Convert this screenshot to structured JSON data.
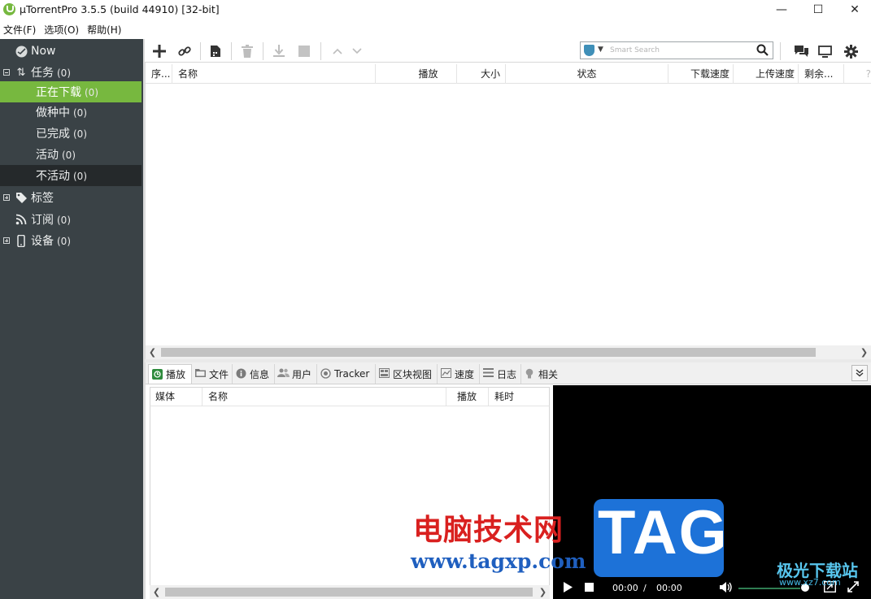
{
  "window": {
    "title": "µTorrentPro 3.5.5  (build 44910) [32-bit]",
    "minimize_glyph": "—",
    "maximize_glyph": "☐",
    "close_glyph": "✕"
  },
  "menu": [
    {
      "label": "文件(F)"
    },
    {
      "label": "选项(O)"
    },
    {
      "label": "帮助(H)"
    }
  ],
  "sidebar": {
    "now": "Now",
    "tasks": {
      "label": "任务",
      "count": "(0)"
    },
    "downloading": {
      "label": "正在下载",
      "count": "(0)"
    },
    "seeding": {
      "label": "做种中",
      "count": "(0)"
    },
    "completed": {
      "label": "已完成",
      "count": "(0)"
    },
    "active": {
      "label": "活动",
      "count": "(0)"
    },
    "inactive": {
      "label": "不活动",
      "count": "(0)"
    },
    "labels": {
      "label": "标签"
    },
    "feeds": {
      "label": "订阅",
      "count": "(0)"
    },
    "devices": {
      "label": "设备",
      "count": "(0)"
    }
  },
  "toolbar": {
    "search_placeholder": "Smart Search",
    "icons": [
      "add-torrent-icon",
      "add-url-icon",
      "create-torrent-icon",
      "remove-icon",
      "start-icon",
      "stop-icon",
      "move-up-icon",
      "move-down-icon",
      "chat-icon",
      "remote-icon",
      "settings-icon"
    ]
  },
  "torrent_table": {
    "columns": [
      "序...",
      "名称",
      "播放",
      "大小",
      "状态",
      "下载速度",
      "上传速度",
      "剩余...",
      "?"
    ]
  },
  "detail_tabs": [
    {
      "label": "播放"
    },
    {
      "label": "文件"
    },
    {
      "label": "信息"
    },
    {
      "label": "用户"
    },
    {
      "label": "Tracker"
    },
    {
      "label": "区块视图"
    },
    {
      "label": "速度"
    },
    {
      "label": "日志"
    },
    {
      "label": "相关"
    }
  ],
  "play_table": {
    "columns": [
      "媒体",
      "名称",
      "播放",
      "耗时"
    ]
  },
  "player": {
    "current_time": "00:00",
    "separator": "/",
    "total_time": "00:00"
  },
  "watermarks": {
    "site_cn": "电脑技术网",
    "site_url": "www.tagxp.com",
    "tag": "TAG",
    "jg": "极光下载站",
    "jg_url": "www.xz7.com"
  },
  "colors": {
    "sidebar_bg": "#3a4246",
    "active_green": "#77b83f",
    "inactive_row": "#25292b"
  }
}
